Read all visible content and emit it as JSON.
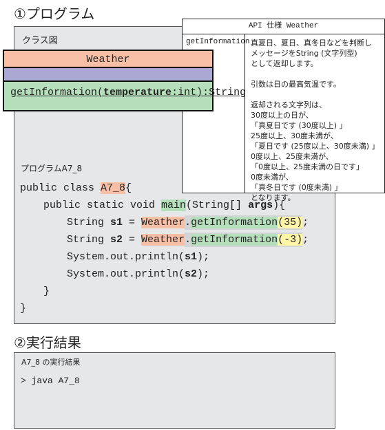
{
  "section1_title": "①プログラム",
  "class_diagram_label": "クラス図",
  "uml": {
    "class_name": "Weather",
    "operation": {
      "prefix": "getInformation(",
      "param": "temperature",
      "suffix": ":int):String"
    }
  },
  "api": {
    "title": "API 仕様 Weather",
    "method": "getInformation",
    "description": [
      "真夏日、夏日、真冬日などを判断し",
      "メッセージをString (文字列型)",
      "として返却します。",
      "",
      "引数は日の最高気温です。",
      "",
      "返却される文字列は、",
      "30度以上の日が、",
      "「真夏日です (30度以上) 」",
      "25度以上、30度未満が、",
      "「夏日です (25度以上、30度未満) 」",
      "0度以上、25度未満が、",
      "「0度以上、25度未満の日です」",
      "0度未満が、",
      "「真冬日です (0度未満) 」",
      "となります。"
    ]
  },
  "program_label": "プログラムA7_8",
  "code": {
    "l1a": "public class ",
    "l1b": "A7_8",
    "l1c": "{",
    "l2a": "public static void ",
    "l2b": "main",
    "l2c": "(String[] ",
    "l2d": "args",
    "l2e": "){",
    "l3a": "String ",
    "l3b": "s1",
    "l3c": " = ",
    "l3d": "Weather",
    "l3e": ".",
    "l3f": "getInformation",
    "l3g": "(35)",
    "l3h": ";",
    "l4a": "String ",
    "l4b": "s2",
    "l4c": " = ",
    "l4d": "Weather",
    "l4e": ".",
    "l4f": "getInformation",
    "l4g": "(-3)",
    "l4h": ";",
    "l5a": "System.out.println(",
    "l5b": "s1",
    "l5c": ");",
    "l6a": "System.out.println(",
    "l6b": "s2",
    "l6c": ");",
    "l7": "}",
    "l8": "}"
  },
  "section2_title": "②実行結果",
  "result_label": "A7_8 の実行結果",
  "result_command": "> java A7_8",
  "colors": {
    "class_red": "#f7bfa6",
    "attr_purple": "#aba8d3",
    "method_green": "#b5dfbb",
    "arg_yellow": "#fff6a8",
    "panel_gray": "#e6e7e9"
  }
}
